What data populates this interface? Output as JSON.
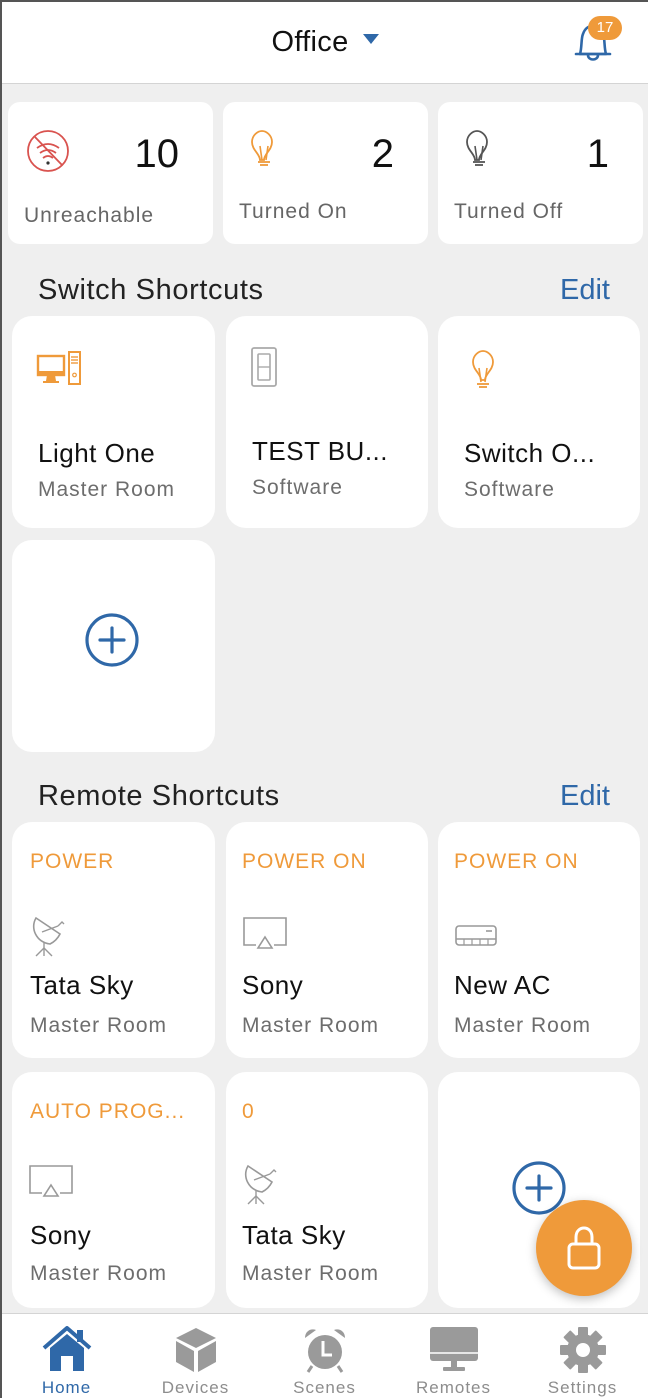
{
  "header": {
    "title": "Office",
    "notification_count": "17"
  },
  "stats": [
    {
      "value": "10",
      "label": "Unreachable",
      "icon": "wifi-off-icon"
    },
    {
      "value": "2",
      "label": "Turned On",
      "icon": "bulb-on-icon"
    },
    {
      "value": "1",
      "label": "Turned Off",
      "icon": "bulb-off-icon"
    }
  ],
  "switch_shortcuts": {
    "title": "Switch Shortcuts",
    "edit_label": "Edit",
    "items": [
      {
        "name": "Light One",
        "room": "Master Room",
        "icon": "computer-icon"
      },
      {
        "name": "TEST BU...",
        "room": "Software",
        "icon": "wall-switch-icon"
      },
      {
        "name": "Switch O...",
        "room": "Software",
        "icon": "bulb-icon"
      }
    ]
  },
  "remote_shortcuts": {
    "title": "Remote Shortcuts",
    "edit_label": "Edit",
    "items": [
      {
        "command": "POWER",
        "name": "Tata Sky",
        "room": "Master Room",
        "icon": "satellite-dish-icon"
      },
      {
        "command": "POWER ON",
        "name": "Sony",
        "room": "Master Room",
        "icon": "tv-icon"
      },
      {
        "command": "POWER ON",
        "name": "New AC",
        "room": "Master Room",
        "icon": "air-conditioner-icon"
      },
      {
        "command": "AUTO PROG...",
        "name": "Sony",
        "room": "Master Room",
        "icon": "tv-icon"
      },
      {
        "command": "0",
        "name": "Tata Sky",
        "room": "Master Room",
        "icon": "satellite-dish-icon"
      }
    ]
  },
  "tabs": [
    {
      "label": "Home",
      "icon": "home-icon",
      "active": true
    },
    {
      "label": "Devices",
      "icon": "cube-icon",
      "active": false
    },
    {
      "label": "Scenes",
      "icon": "alarm-clock-icon",
      "active": false
    },
    {
      "label": "Remotes",
      "icon": "monitor-icon",
      "active": false
    },
    {
      "label": "Settings",
      "icon": "gear-icon",
      "active": false
    }
  ],
  "colors": {
    "accent_blue": "#2f68a8",
    "accent_orange": "#ef9a3a",
    "error_red": "#d9534f",
    "background": "#efefef"
  }
}
